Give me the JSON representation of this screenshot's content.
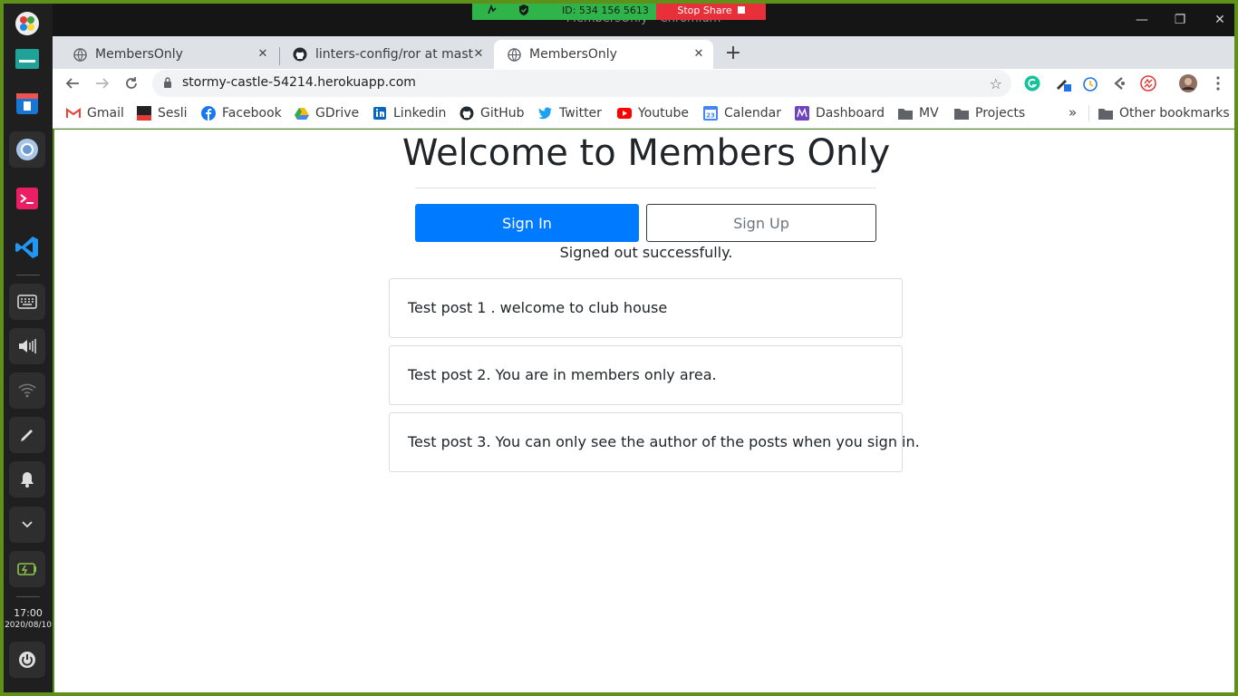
{
  "window": {
    "title": "MembersOnly - Chromium"
  },
  "share": {
    "id_text": "ID: 534 156 5613",
    "stop_label": "Stop Share"
  },
  "dock": {
    "time": "17:00",
    "date": "2020/08/10"
  },
  "tabs": [
    {
      "label": "MembersOnly",
      "icon": "globe-icon",
      "active": false
    },
    {
      "label": "linters-config/ror at maste",
      "icon": "github-icon",
      "active": false
    },
    {
      "label": "MembersOnly",
      "icon": "globe-icon",
      "active": true
    }
  ],
  "toolbar": {
    "url": "stormy-castle-54214.herokuapp.com"
  },
  "bookmarks": [
    {
      "label": "Gmail",
      "icon": "gmail-icon",
      "color": "#ea4335"
    },
    {
      "label": "Sesli",
      "icon": "sesli-icon",
      "color": "#b71c1c"
    },
    {
      "label": "Facebook",
      "icon": "facebook-icon",
      "color": "#1877f2"
    },
    {
      "label": "GDrive",
      "icon": "gdrive-icon",
      "color": "#34a853"
    },
    {
      "label": "Linkedin",
      "icon": "linkedin-icon",
      "color": "#0a66c2"
    },
    {
      "label": "GitHub",
      "icon": "github-icon",
      "color": "#24292e"
    },
    {
      "label": "Twitter",
      "icon": "twitter-icon",
      "color": "#1da1f2"
    },
    {
      "label": "Youtube",
      "icon": "youtube-icon",
      "color": "#ff0000"
    },
    {
      "label": "Calendar",
      "icon": "calendar-icon",
      "color": "#4285f4"
    },
    {
      "label": "Dashboard",
      "icon": "dashboard-icon",
      "color": "#6f42c1"
    },
    {
      "label": "MV",
      "icon": "folder-icon",
      "color": "#5f6368"
    },
    {
      "label": "Projects",
      "icon": "folder-icon",
      "color": "#5f6368"
    }
  ],
  "other_bookmarks": "Other bookmarks",
  "page": {
    "heading": "Welcome to Members Only",
    "sign_in": "Sign In",
    "sign_up": "Sign Up",
    "notice": "Signed out successfully.",
    "posts": [
      "Test post 1 . welcome to club house",
      "Test post 2. You are in members only area.",
      "Test post 3. You can only see the author of the posts when you sign in."
    ]
  },
  "colors": {
    "primary": "#007bff",
    "frame": "#5f9019",
    "share_green": "#2fb44a",
    "share_red": "#e8303a"
  }
}
